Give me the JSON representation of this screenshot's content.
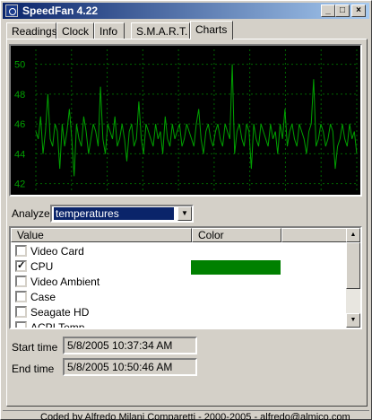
{
  "window": {
    "title": "SpeedFan 4.22"
  },
  "tabs": [
    {
      "label": "Readings"
    },
    {
      "label": "Clock"
    },
    {
      "label": "Info"
    },
    {
      "label": "S.M.A.R.T."
    },
    {
      "label": "Charts"
    }
  ],
  "chart_data": {
    "type": "line",
    "yticks": [
      "50",
      "48",
      "46",
      "44",
      "42"
    ],
    "ylim": [
      41.5,
      51
    ],
    "grid": true,
    "series": [
      {
        "color": "#00a000",
        "values": [
          45.5,
          45,
          46.5,
          44,
          45.5,
          48,
          45,
          44.5,
          46,
          45.5,
          43,
          46,
          44.5,
          45.5,
          47,
          45,
          42.5,
          46,
          45,
          44.5,
          46.5,
          45.5,
          44,
          45,
          46,
          45.5,
          44.5,
          48.5,
          45,
          44,
          46,
          45.5,
          45,
          46.5,
          44.5,
          45,
          46,
          45,
          43.5,
          45.5,
          46,
          44.5,
          45,
          47.5,
          45,
          44,
          46,
          45.5,
          45,
          44.5,
          46,
          45,
          45.5,
          44,
          46.5,
          45,
          44.5,
          46,
          45,
          45.5,
          46,
          44.5,
          45,
          46,
          45.5,
          45,
          44.5,
          46,
          47,
          45,
          44,
          45.5,
          46,
          45,
          44.5,
          45.5,
          46,
          45,
          44.5,
          46,
          45.5,
          45,
          50,
          44,
          45.5,
          46,
          45,
          44.5,
          46,
          45.5,
          43,
          46,
          45,
          44.5,
          46,
          45.5,
          45,
          44.5,
          46,
          45,
          45.5,
          44,
          46,
          45,
          47,
          44.5,
          45.5,
          46,
          45,
          44.5,
          46,
          45.5,
          45,
          44,
          45.5,
          46,
          49,
          44.5,
          45,
          46,
          45.5,
          44.5,
          45,
          46,
          45.5,
          43,
          44.5,
          45,
          46,
          45,
          44.5,
          46,
          45,
          45.5,
          44
        ]
      }
    ]
  },
  "analyze": {
    "label": "Analyze",
    "selected": "temperatures"
  },
  "list": {
    "columns": [
      "Value",
      "Color"
    ],
    "items": [
      {
        "label": "Video Card",
        "checked": false,
        "color": ""
      },
      {
        "label": "CPU",
        "checked": true,
        "color": "#008000"
      },
      {
        "label": "Video Ambient",
        "checked": false,
        "color": ""
      },
      {
        "label": "Case",
        "checked": false,
        "color": ""
      },
      {
        "label": "Seagate HD",
        "checked": false,
        "color": ""
      },
      {
        "label": "ACPI Temp",
        "checked": false,
        "color": ""
      }
    ]
  },
  "times": {
    "start_label": "Start time",
    "start_value": "5/8/2005 10:37:34 AM",
    "end_label": "End time",
    "end_value": "5/8/2005 10:50:46 AM"
  },
  "status": {
    "text": "Coded by Alfredo Milani Comparetti - 2000-2005 - alfredo@almico.com"
  }
}
